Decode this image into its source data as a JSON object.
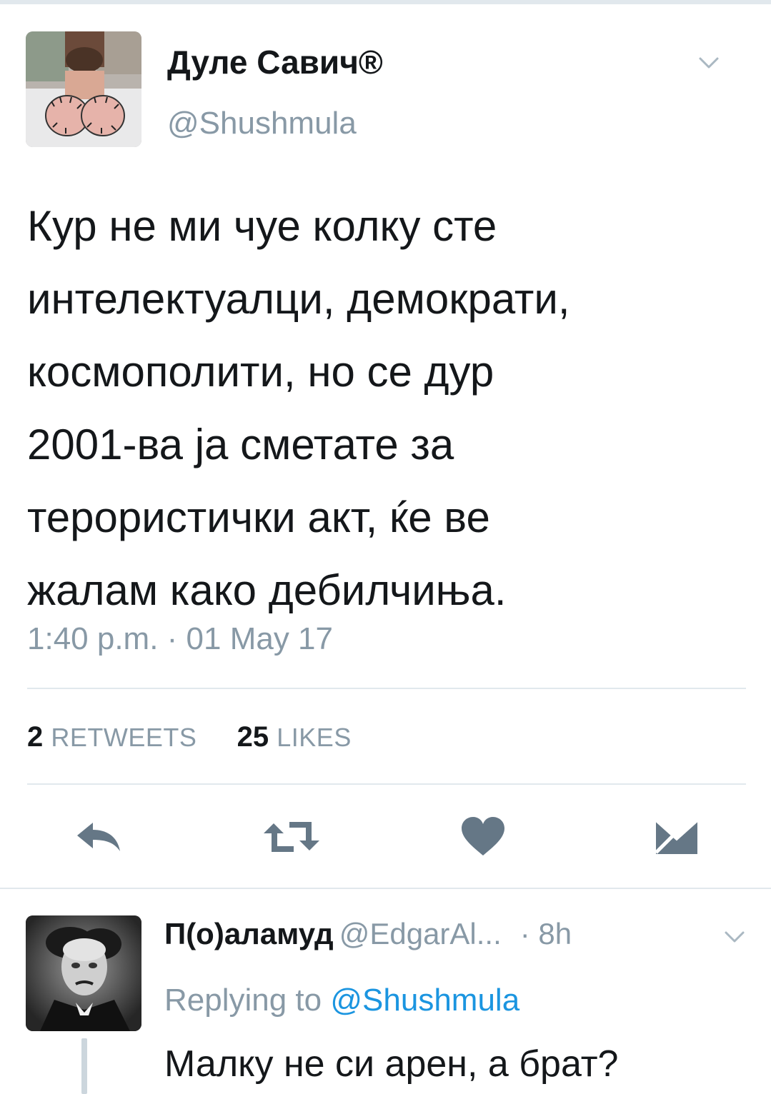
{
  "tweet": {
    "author_name": "Дуле Савич®",
    "author_handle": "@Shushmula",
    "text_lines": [
      "Кур не ми чуе колку сте",
      "интелектуалци, демократи,",
      "космополити, но се дур",
      "2001-ва ја сметате за",
      "терористички акт, ќе ве",
      "жалам како дебилчиња."
    ],
    "timestamp": "1:40 p.m. · 01 May 17",
    "retweets_count": "2",
    "retweets_label": "RETWEETS",
    "likes_count": "25",
    "likes_label": "LIKES"
  },
  "actions": {
    "reply_icon": "reply-icon",
    "retweet_icon": "retweet-icon",
    "like_icon": "heart-icon",
    "message_icon": "envelope-icon"
  },
  "reply": {
    "author_name": "П(о)аламуд",
    "author_handle": "@EdgarAl...",
    "time": "· 8h",
    "replying_to_label": "Replying to",
    "replying_to_handle": "@Shushmula",
    "text": "Малку не си арен, а брат?"
  },
  "colors": {
    "text": "#14171a",
    "secondary": "#8899a6",
    "link": "#1b95e0",
    "divider": "#e1e8ed",
    "icon": "#657786"
  }
}
